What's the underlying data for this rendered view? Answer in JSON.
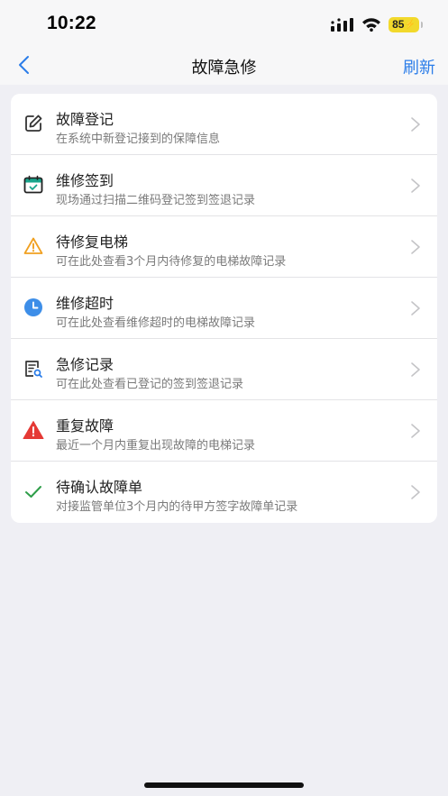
{
  "status_bar": {
    "time": "10:22",
    "battery": "85"
  },
  "nav": {
    "title": "故障急修",
    "refresh_label": "刷新"
  },
  "items": [
    {
      "title": "故障登记",
      "subtitle": "在系统中新登记接到的保障信息",
      "icon": "edit-icon"
    },
    {
      "title": "维修签到",
      "subtitle": "现场通过扫描二维码登记签到签退记录",
      "icon": "calendar-check-icon"
    },
    {
      "title": "待修复电梯",
      "subtitle": "可在此处查看3个月内待修复的电梯故障记录",
      "icon": "warning-outline-icon"
    },
    {
      "title": "维修超时",
      "subtitle": "可在此处查看维修超时的电梯故障记录",
      "icon": "clock-icon"
    },
    {
      "title": "急修记录",
      "subtitle": "可在此处查看已登记的签到签退记录",
      "icon": "document-search-icon"
    },
    {
      "title": "重复故障",
      "subtitle": "最近一个月内重复出现故障的电梯记录",
      "icon": "warning-filled-icon"
    },
    {
      "title": "待确认故障单",
      "subtitle": "对接监管单位3个月内的待甲方签字故障单记录",
      "icon": "checkmark-icon"
    }
  ],
  "colors": {
    "accent": "#2b7de9",
    "warning": "#f0a020",
    "danger": "#e53935",
    "success": "#2e9e49",
    "teal": "#1aa58c"
  }
}
